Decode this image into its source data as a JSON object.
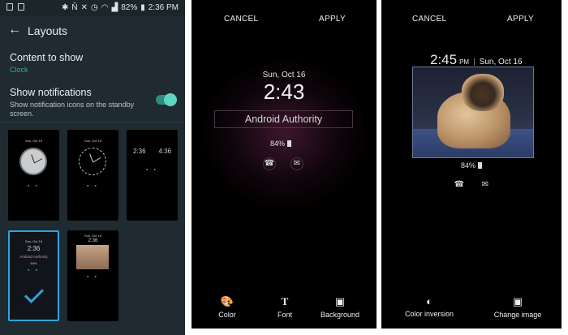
{
  "phone1": {
    "status": {
      "time": "2:36 PM",
      "battery": "82%",
      "icons": [
        "bluetooth-icon",
        "nfc-icon",
        "mute-icon",
        "alarm-icon",
        "wifi-icon",
        "signal-icon",
        "battery-icon"
      ]
    },
    "appbar": {
      "title": "Layouts",
      "back_icon": "arrow-left-icon"
    },
    "content_to_show": {
      "title": "Content to show",
      "value": "Clock"
    },
    "show_notifications": {
      "title": "Show notifications",
      "subtitle": "Show notification icons on the standby screen.",
      "enabled": true
    },
    "accent": "#27b39a",
    "selected_border": "#2ba7d8",
    "layouts": [
      {
        "date": "Sun, Oct 16",
        "style": "analog-light"
      },
      {
        "date": "Sun, Oct 16",
        "style": "analog-dark"
      },
      {
        "style": "dual-clock",
        "times": [
          "2:36",
          "4:36"
        ]
      },
      {
        "date": "Sun, Oct 16",
        "time": "2:36",
        "text": "Android Authority",
        "battery": "84%",
        "selected": true
      },
      {
        "date": "Sun, Oct 16",
        "time": "2:36",
        "style": "photo"
      }
    ]
  },
  "phone2": {
    "cancel": "CANCEL",
    "apply": "APPLY",
    "date": "Sun, Oct 16",
    "time": "2:43",
    "text": "Android Authority",
    "battery": "84%",
    "icons": [
      "missed-call-icon",
      "email-icon"
    ],
    "tools": [
      {
        "label": "Color",
        "icon": "palette-icon"
      },
      {
        "label": "Font",
        "icon": "text-icon"
      },
      {
        "label": "Background",
        "icon": "image-icon"
      }
    ]
  },
  "phone3": {
    "cancel": "CANCEL",
    "apply": "APPLY",
    "time": "2:45",
    "ampm": "PM",
    "date": "Sun, Oct 16",
    "battery": "84%",
    "icons": [
      "missed-call-icon",
      "email-icon"
    ],
    "tools": [
      {
        "label": "Color inversion",
        "icon": "invert-colors-icon"
      },
      {
        "label": "Change image",
        "icon": "image-icon"
      }
    ]
  }
}
